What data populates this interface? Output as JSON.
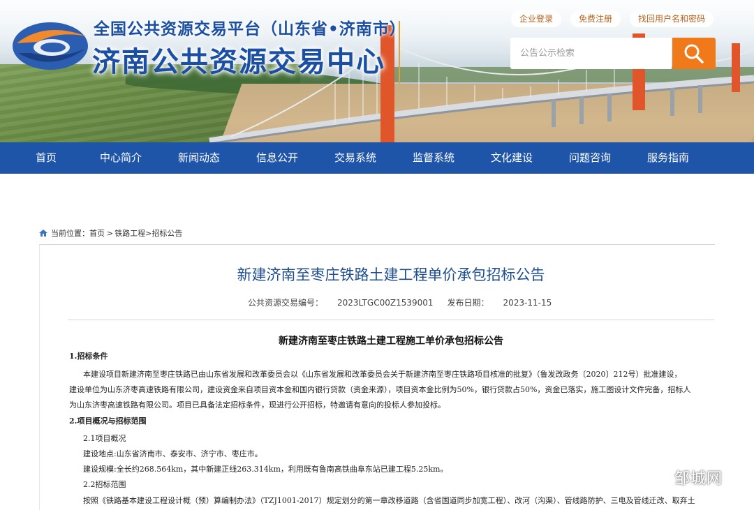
{
  "header": {
    "platform_title": "全国公共资源交易平台（山东省•济南市）",
    "center_title": "济南公共资源交易中心",
    "links": [
      "企业登录",
      "免费注册",
      "找回用户名和密码"
    ],
    "search_placeholder": "公告公示检索"
  },
  "nav": [
    "首页",
    "中心简介",
    "新闻动态",
    "信息公开",
    "交易系统",
    "监督系统",
    "文化建设",
    "问题咨询",
    "服务指南"
  ],
  "breadcrumb": {
    "prefix": "当前位置：",
    "home": "首页",
    "sep1": ">",
    "category": "铁路工程",
    "sep2": ">",
    "page": "招标公告"
  },
  "article": {
    "title": "新建济南至枣庄铁路土建工程单价承包招标公告",
    "code_label": "公共资源交易编号：",
    "code": "2023LTGC00Z1539001",
    "date_label": "发布日期：",
    "date": "2023-11-15",
    "subtitle": "新建济南至枣庄铁路土建工程施工单价承包招标公告",
    "sec1": "1.招标条件",
    "p1_l1": "本建设项目新建济南至枣庄铁路已由山东省发展和改革委员会以《山东省发展和改革委员会关于新建济南至枣庄铁路项目核准的批复》（鲁发改政务〔2020〕212号）批准建设，",
    "p1_l2": "建设单位为山东济枣高速铁路有限公司，建设资金来自项目资本金和国内银行贷款（资金来源），项目资本金比例为50%，银行贷款占50%，资金已落实，施工图设计文件完备，招标人",
    "p1_l3": "为山东济枣高速铁路有限公司。项目已具备法定招标条件，现进行公开招标，特邀请有意向的投标人参加投标。",
    "sec2": "2.项目概况与招标范围",
    "s21": "2.1项目概况",
    "loc": "建设地点:山东省济南市、泰安市、济宁市、枣庄市。",
    "scale": "建设规模:全长约268.564km，其中新建正线263.314km，利用既有鲁南高铁曲阜东站已建工程5.25km。",
    "s22": "2.2招标范围",
    "range": "按照《铁路基本建设工程设计概（预）算编制办法》（TZJ1001-2017）规定划分的第一章改移道路（含省国道同步加宽工程）、改河（沟渠）、管线路防护、三电及管线迁改、取弃土"
  },
  "watermark": "邹城网",
  "colors": {
    "nav_bg": "#1f55a8",
    "title_blue": "#1b4fa3",
    "search_btn": "#f07a1a",
    "link_orange": "#b4611d"
  }
}
